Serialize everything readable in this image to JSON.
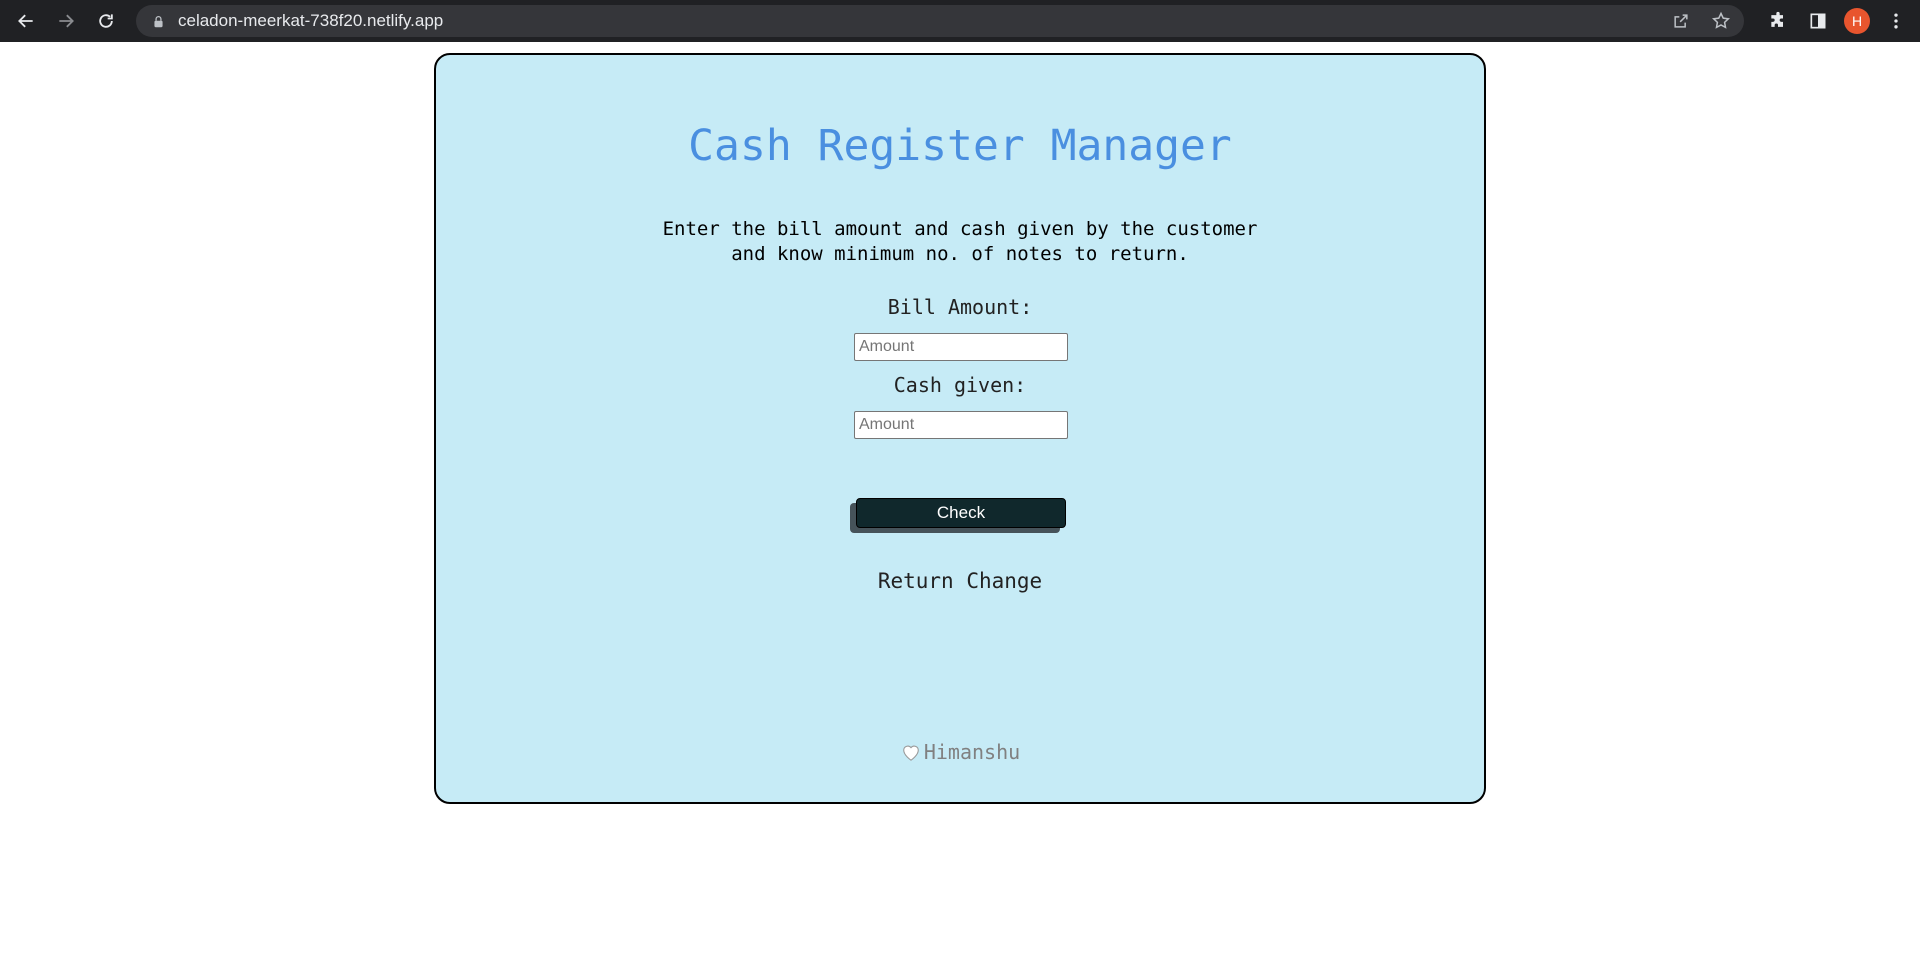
{
  "browser": {
    "url": "celadon-meerkat-738f20.netlify.app",
    "profile_initial": "H",
    "profile_color": "#e8552e"
  },
  "app": {
    "title": "Cash Register Manager",
    "description_line1": "Enter the bill amount and cash given by the customer",
    "description_line2": "and know minimum no. of notes to return.",
    "bill_label": "Bill Amount:",
    "bill_placeholder": "Amount",
    "bill_value": "",
    "cash_label": "Cash given:",
    "cash_placeholder": "Amount",
    "cash_value": "",
    "check_label": "Check",
    "return_label": "Return Change",
    "footer_name": "Himanshu"
  },
  "colors": {
    "card_background": "#c6ebf6",
    "title": "#4a8fe0",
    "button": "#10282c"
  }
}
